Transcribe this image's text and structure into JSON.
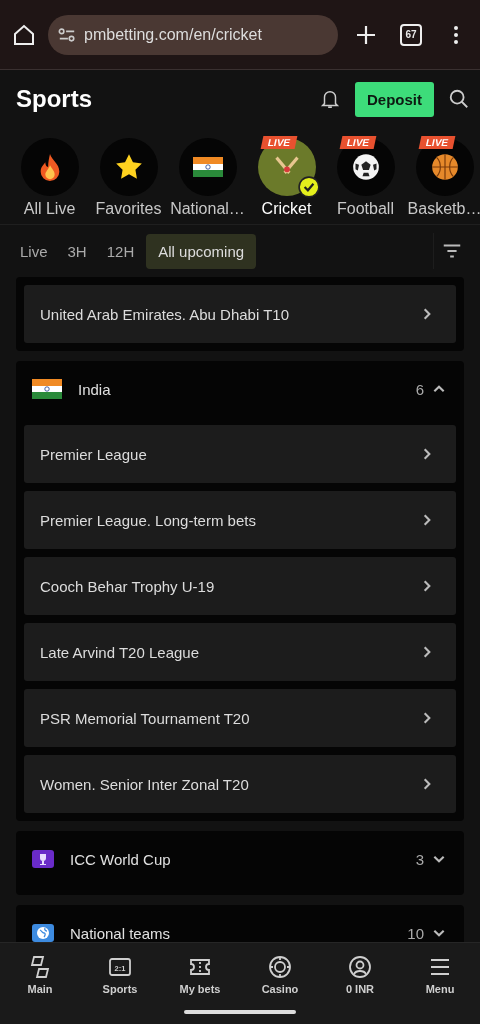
{
  "browser": {
    "url": "pmbetting.com/en/cricket",
    "tab_count": "67"
  },
  "header": {
    "title": "Sports",
    "deposit": "Deposit"
  },
  "categories": [
    {
      "label": "All Live",
      "kind": "fire",
      "live": false,
      "selected": false
    },
    {
      "label": "Favorites",
      "kind": "star",
      "live": false,
      "selected": false
    },
    {
      "label": "National…",
      "kind": "flag",
      "live": false,
      "selected": false
    },
    {
      "label": "Cricket",
      "kind": "cricket",
      "live": true,
      "live_label": "LIVE",
      "selected": true
    },
    {
      "label": "Football",
      "kind": "football",
      "live": true,
      "live_label": "LIVE",
      "selected": false
    },
    {
      "label": "Basketb…",
      "kind": "basketball",
      "live": true,
      "live_label": "LIVE",
      "selected": false
    }
  ],
  "time_filters": [
    {
      "label": "Live",
      "selected": false
    },
    {
      "label": "3H",
      "selected": false
    },
    {
      "label": "12H",
      "selected": false
    },
    {
      "label": "All upcoming",
      "selected": true
    }
  ],
  "groups": [
    {
      "items": [
        "United Arab Emirates. Abu Dhabi T10"
      ]
    },
    {
      "name": "India",
      "kind": "flag",
      "count": "6",
      "expanded": true,
      "items": [
        "Premier League",
        "Premier League. Long-term bets",
        "Cooch Behar Trophy U-19",
        "Late Arvind T20 League",
        "PSR Memorial Tournament T20",
        "Women. Senior Inter Zonal T20"
      ]
    },
    {
      "name": "ICC World Cup",
      "kind": "trophy",
      "count": "3",
      "expanded": false
    },
    {
      "name": "National teams",
      "kind": "globe",
      "count": "10",
      "expanded": false
    }
  ],
  "nav": [
    {
      "label": "Main",
      "kind": "main"
    },
    {
      "label": "Sports",
      "kind": "score",
      "icon_text": "2:1"
    },
    {
      "label": "My bets",
      "kind": "ticket"
    },
    {
      "label": "Casino",
      "kind": "chip"
    },
    {
      "label": "0 INR",
      "kind": "user"
    },
    {
      "label": "Menu",
      "kind": "menu"
    }
  ]
}
